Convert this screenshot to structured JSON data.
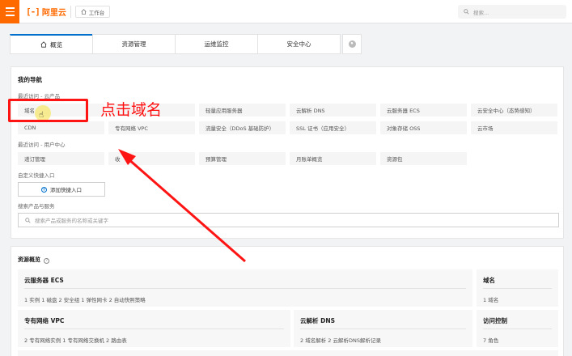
{
  "header": {
    "logo_mark": "[-]",
    "logo_text": "阿里云",
    "workbench_label": "工作台",
    "search_placeholder": "搜索..."
  },
  "tabs": [
    {
      "label": "概览",
      "active": true,
      "icon": "home-icon"
    },
    {
      "label": "资源管理",
      "active": false
    },
    {
      "label": "运维监控",
      "active": false
    },
    {
      "label": "安全中心",
      "active": false
    }
  ],
  "nav": {
    "title": "我的导航",
    "recent_products_title": "最近访问 - 云产品",
    "recent_products": [
      "域名",
      "",
      "轻量应用服务器",
      "云解析 DNS",
      "云服务器 ECS",
      "云安全中心（态势感知）",
      "CDN",
      "专有网络 VPC",
      "流量安全（DDoS 基础防护）",
      "SSL 证书（应用安全）",
      "对象存储 OSS",
      "云市场"
    ],
    "recent_user_title": "最近访问 - 用户中心",
    "recent_user": [
      "递订管理",
      "收",
      "预算管理",
      "月账单概览",
      "资源包"
    ],
    "custom_entry_title": "自定义快捷入口",
    "add_quick_label": "添加快捷入口",
    "search_title": "搜索产品与服务",
    "search_placeholder": "搜索产品或服务的名称或关键字"
  },
  "resources": {
    "title": "资源概览",
    "cards": [
      {
        "title": "云服务器 ECS",
        "sub": "1 实例  1 磁盘  2 安全组  1 弹性网卡  2 自动快照策略"
      },
      {
        "title": "域名",
        "sub": "1 域名"
      },
      {
        "title": "专有网络 VPC",
        "sub": "2 专有网络实例  1 专有网络交换机  2 路由表"
      },
      {
        "title": "云解析 DNS",
        "sub": "2 域名解析  2 云解析DNS解析记录"
      },
      {
        "title": "访问控制",
        "sub": "7 角色"
      }
    ]
  },
  "annotation": {
    "text": "点击域名",
    "color": "#ff1010"
  },
  "colors": {
    "brand": "#ff6a00",
    "accent": "#0070cc",
    "annotation_red": "#ff1414"
  }
}
